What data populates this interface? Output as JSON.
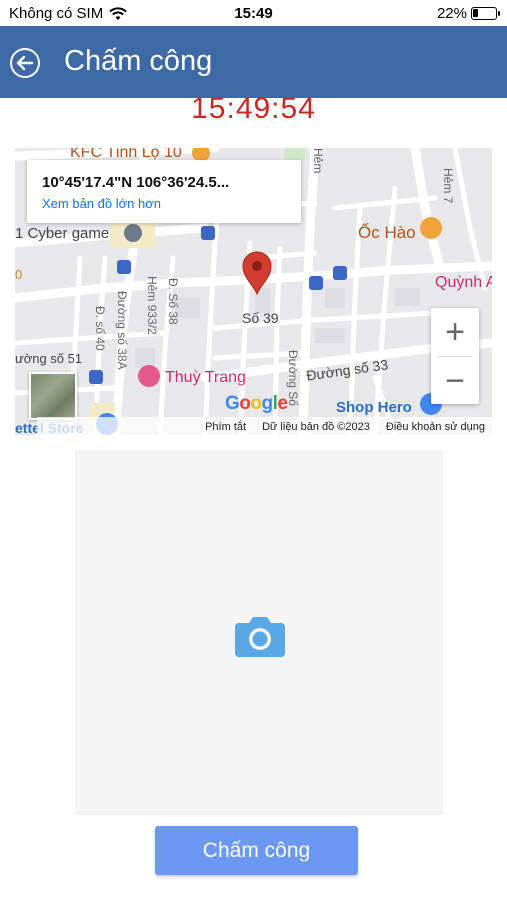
{
  "status_bar": {
    "carrier": "Không có SIM",
    "time": "15:49",
    "battery_percent": "22%",
    "battery_level": 0.22,
    "wifi_icon": "wifi-icon"
  },
  "header": {
    "title": "Chấm công",
    "back_icon": "back-arrow-icon",
    "background": "#3d6aa6"
  },
  "clock": {
    "value": "15:49:54",
    "color": "#c42a22"
  },
  "map": {
    "coordinates": "10°45'17.4\"N 106°36'24.5...",
    "larger_map_link": "Xem bản đồ lớn hơn",
    "labels": {
      "kfc": "KFC Tỉnh Lộ 10",
      "cyber": "1 Cyber game",
      "oc_hao": "Ốc Hào",
      "quynh": "Quỳnh A",
      "so39": "Số 39",
      "duong33": "Đường số 33",
      "thuy_trang": "Thuỳ Trang",
      "shop_hero": "Shop Hero",
      "viettel": "ettel Store",
      "duong51": "ường số 51",
      "hem933": "Hẻm 933/2",
      "ds40": "Đ. số 40",
      "duong38a": "Đường số 38A",
      "ds38": "Đ. Số 38",
      "duong_so": "Đường Số",
      "hem7": "Hẻm 7",
      "hem_top": "Hẻm",
      "zero": "0"
    },
    "zoom_in": "+",
    "zoom_out": "−",
    "google": [
      "G",
      "o",
      "o",
      "g",
      "l",
      "e"
    ],
    "attribution": {
      "shortcuts": "Phím tắt",
      "map_data": "Dữ liệu bản đồ ©2023",
      "terms": "Điều khoản sử dụng"
    }
  },
  "photo": {
    "icon": "camera-icon"
  },
  "submit": {
    "label": "Chấm công",
    "color": "#6b98f1"
  }
}
